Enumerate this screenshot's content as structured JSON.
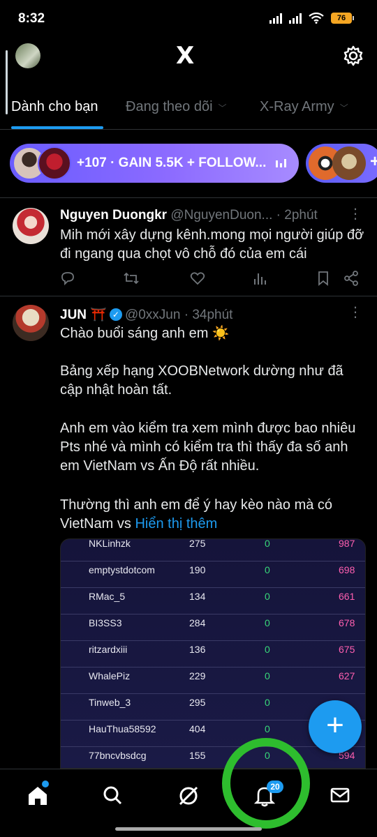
{
  "status": {
    "time": "8:32",
    "battery": "76"
  },
  "header": {
    "logo": "X"
  },
  "tabs": [
    {
      "label": "Dành cho bạn"
    },
    {
      "label": "Đang theo dõi"
    },
    {
      "label": "X-Ray Army"
    }
  ],
  "spaces": {
    "pill_text": "+107 · GAIN 5.5K + FOLLOW...",
    "second_pill_plus": "+"
  },
  "posts": [
    {
      "name": "Nguyen Duongkr",
      "handle": "@NguyenDuon...",
      "time": "· 2phút",
      "text": "Mih mới xây dựng kênh.mong mọi người giúp đỡ đi ngang qua chọt vô chỗ đó của em cái"
    },
    {
      "name": "JUN ⛩️",
      "handle": "@0xxJun",
      "time": "· 34phút",
      "text1": "Chào buổi sáng anh em ☀️",
      "text2": "Bảng xếp hạng XOOBNetwork dường như đã cập nhật hoàn tất.",
      "text3": "Anh em vào kiểm tra xem mình được bao nhiêu Pts nhé và mình có kiểm tra thì thấy đa số anh em VietNam vs Ấn Độ rất nhiều.",
      "text4": "Thường thì anh em để ý hay kèo nào mà có VietNam vs",
      "show_more": "Hiển thị thêm"
    }
  ],
  "table_rows": [
    {
      "name": "NKLinhzk",
      "a": "275",
      "b": "0",
      "c": "987"
    },
    {
      "name": "emptystdotcom",
      "a": "190",
      "b": "0",
      "c": "698"
    },
    {
      "name": "RMac_5",
      "a": "134",
      "b": "0",
      "c": "661"
    },
    {
      "name": "BI3SS3",
      "a": "284",
      "b": "0",
      "c": "678"
    },
    {
      "name": "ritzardxiii",
      "a": "136",
      "b": "0",
      "c": "675"
    },
    {
      "name": "WhalePiz",
      "a": "229",
      "b": "0",
      "c": "627"
    },
    {
      "name": "Tinweb_3",
      "a": "295",
      "b": "0",
      "c": ""
    },
    {
      "name": "HauThua58592",
      "a": "404",
      "b": "0",
      "c": ""
    },
    {
      "name": "77bncvbsdcg",
      "a": "155",
      "b": "0",
      "c": "594"
    }
  ],
  "fab": {
    "icon": "+"
  },
  "bottom_nav": {
    "notifications_badge": "20"
  },
  "colors": {
    "accent": "#1d9bf0",
    "highlight_ring": "#2ebd2e",
    "space_pill": "#8c6bff"
  }
}
